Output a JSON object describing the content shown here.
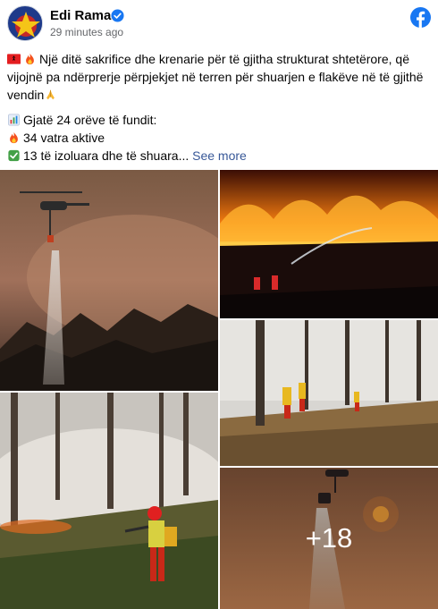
{
  "post": {
    "author": {
      "name": "Edi Rama",
      "verified": true,
      "timestamp": "29 minutes ago",
      "avatar_icon": "avatar-star-logo"
    },
    "platform_icon": "facebook-logo",
    "text": {
      "line1": "Një ditë sakrifice dhe krenarie për të gjitha strukturat shtetërore, që",
      "line2": "vijojnë pa ndërprerje përpjekjet në terren për shuarjen e flakëve në të gjithë",
      "line3": "vendin",
      "stat1": "Gjatë 24 orëve të fundit:",
      "stat2": "34 vatra aktive",
      "stat3": "13 të izoluara dhe të shuara...",
      "see_more": "See more"
    },
    "photos": {
      "remaining_count": "+18"
    }
  },
  "colors": {
    "facebook_blue": "#1877f2",
    "link_blue": "#385898",
    "meta_gray": "#65676b"
  }
}
